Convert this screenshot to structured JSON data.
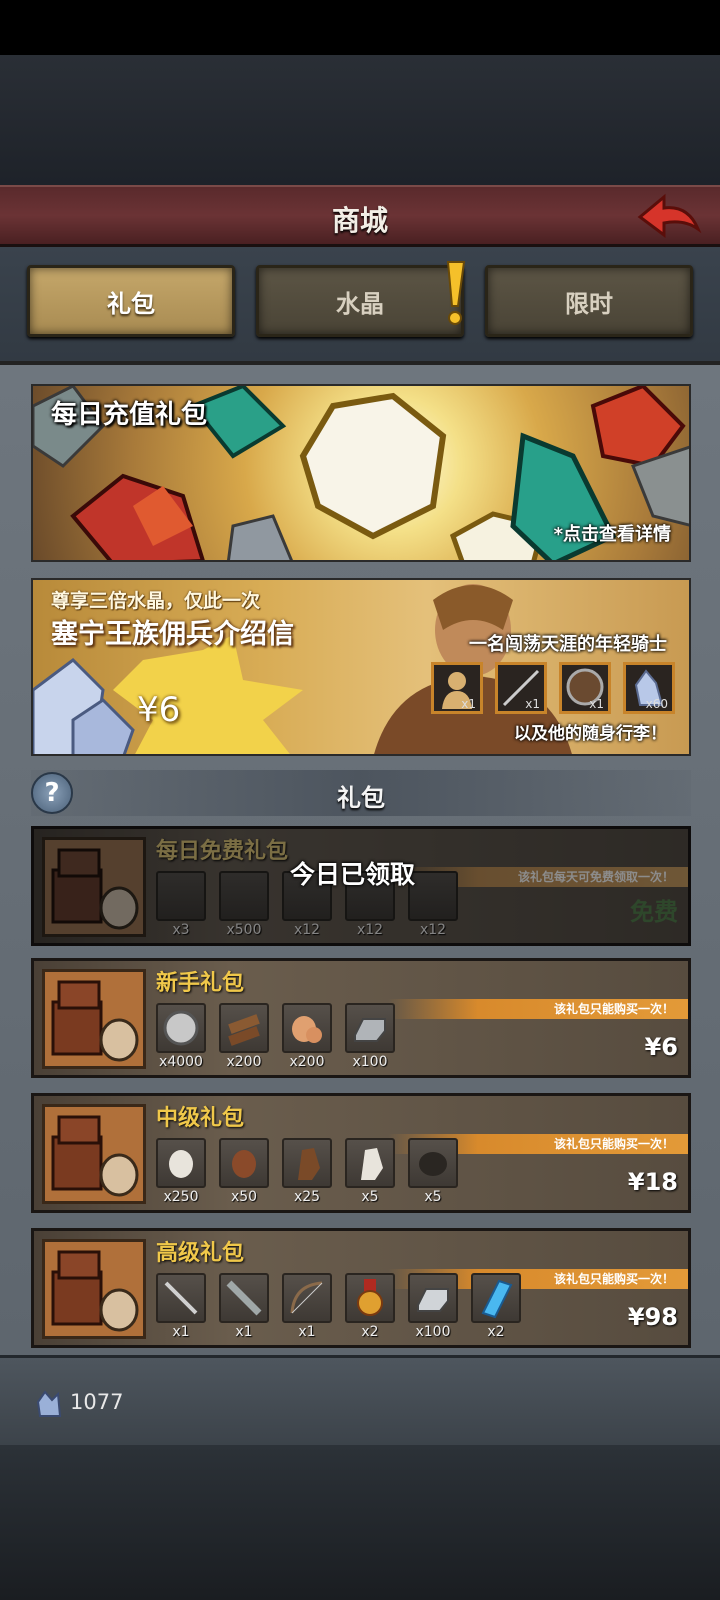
{
  "header": {
    "title": "商城"
  },
  "tabs": [
    {
      "label": "礼包",
      "active": true
    },
    {
      "label": "水晶",
      "active": false,
      "alert": true
    },
    {
      "label": "限时",
      "active": false
    }
  ],
  "banner_daily": {
    "title": "每日充值礼包",
    "note": "*点击查看详情"
  },
  "banner_letter": {
    "line1": "尊享三倍水晶，仅此一次",
    "line2": "塞宁王族佣兵介绍信",
    "price": "¥6",
    "knight": "一名闯荡天涯的年轻骑士",
    "items": [
      {
        "icon": "mercenary-icon",
        "qty": "x1"
      },
      {
        "icon": "spear-icon",
        "qty": "x1"
      },
      {
        "icon": "shield-icon",
        "qty": "x1"
      },
      {
        "icon": "crystal-icon",
        "qty": "x60"
      }
    ],
    "follow": "以及他的随身行李！"
  },
  "section": {
    "title": "礼包",
    "help": "?"
  },
  "packs": [
    {
      "name": "每日免费礼包",
      "ribbon": "该礼包每天可免费领取一次！",
      "status": "今日已领取",
      "price": "免费",
      "items": [
        {
          "icon": "crystal-ore-icon",
          "qty": "x3"
        },
        {
          "icon": "silver-coin-icon",
          "qty": "x500"
        },
        {
          "icon": "wood-icon",
          "qty": "x12"
        },
        {
          "icon": "food-icon",
          "qty": "x12"
        },
        {
          "icon": "iron-ingot-icon",
          "qty": "x12"
        }
      ]
    },
    {
      "name": "新手礼包",
      "ribbon": "该礼包只能购买一次！",
      "price": "¥6",
      "items": [
        {
          "icon": "silver-coin-icon",
          "qty": "x4000"
        },
        {
          "icon": "wood-icon",
          "qty": "x200"
        },
        {
          "icon": "food-icon",
          "qty": "x200"
        },
        {
          "icon": "iron-ingot-icon",
          "qty": "x100"
        }
      ]
    },
    {
      "name": "中级礼包",
      "ribbon": "该礼包只能购买一次！",
      "price": "¥18",
      "items": [
        {
          "icon": "sheep-icon",
          "qty": "x250"
        },
        {
          "icon": "cow-icon",
          "qty": "x50"
        },
        {
          "icon": "brown-horse-icon",
          "qty": "x25"
        },
        {
          "icon": "white-horse-icon",
          "qty": "x5"
        },
        {
          "icon": "black-sheep-icon",
          "qty": "x5"
        }
      ]
    },
    {
      "name": "高级礼包",
      "ribbon": "该礼包只能购买一次！",
      "price": "¥98",
      "items": [
        {
          "icon": "sword-icon",
          "qty": "x1"
        },
        {
          "icon": "greatsword-icon",
          "qty": "x1"
        },
        {
          "icon": "bow-icon",
          "qty": "x1"
        },
        {
          "icon": "medal-icon",
          "qty": "x2"
        },
        {
          "icon": "iron-ingot-icon",
          "qty": "x100"
        },
        {
          "icon": "blue-crystal-icon",
          "qty": "x2"
        }
      ]
    }
  ],
  "footer": {
    "crystals": "1077"
  },
  "colors": {
    "title_bar": "#6b3335",
    "tab_active": "#c5a76a",
    "pack_name": "#f0c84a",
    "ribbon": "#d88a2c",
    "free_green": "#3f8a36"
  }
}
